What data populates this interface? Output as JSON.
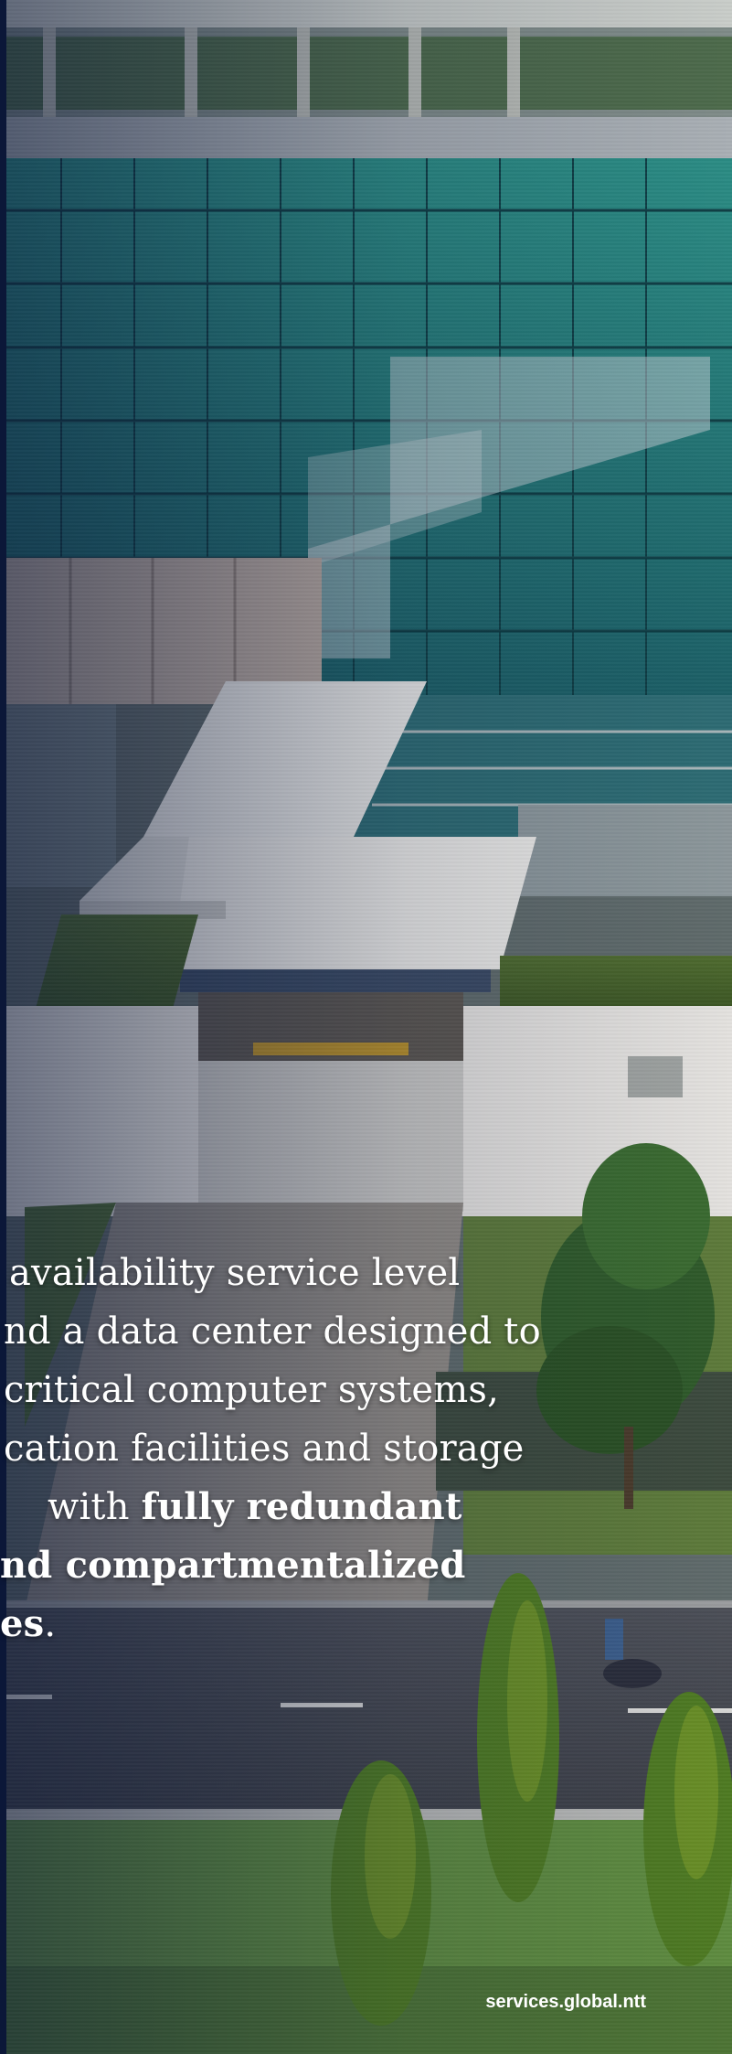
{
  "body_text": {
    "line1": "availability service level",
    "line2": "nd a data center designed to",
    "line3": "critical computer systems,",
    "line4": "cation facilities and storage",
    "line5_prefix": "with ",
    "line5_bold": "fully redundant",
    "line6_bold": "nd compartmentalized",
    "line7_bold": "es",
    "line7_suffix": "."
  },
  "footer": {
    "url": "services.global.ntt"
  },
  "colors": {
    "edge_bar": "#0b1738",
    "text": "#ffffff"
  },
  "photo": {
    "subject": "aerial-photo-data-center-building"
  }
}
